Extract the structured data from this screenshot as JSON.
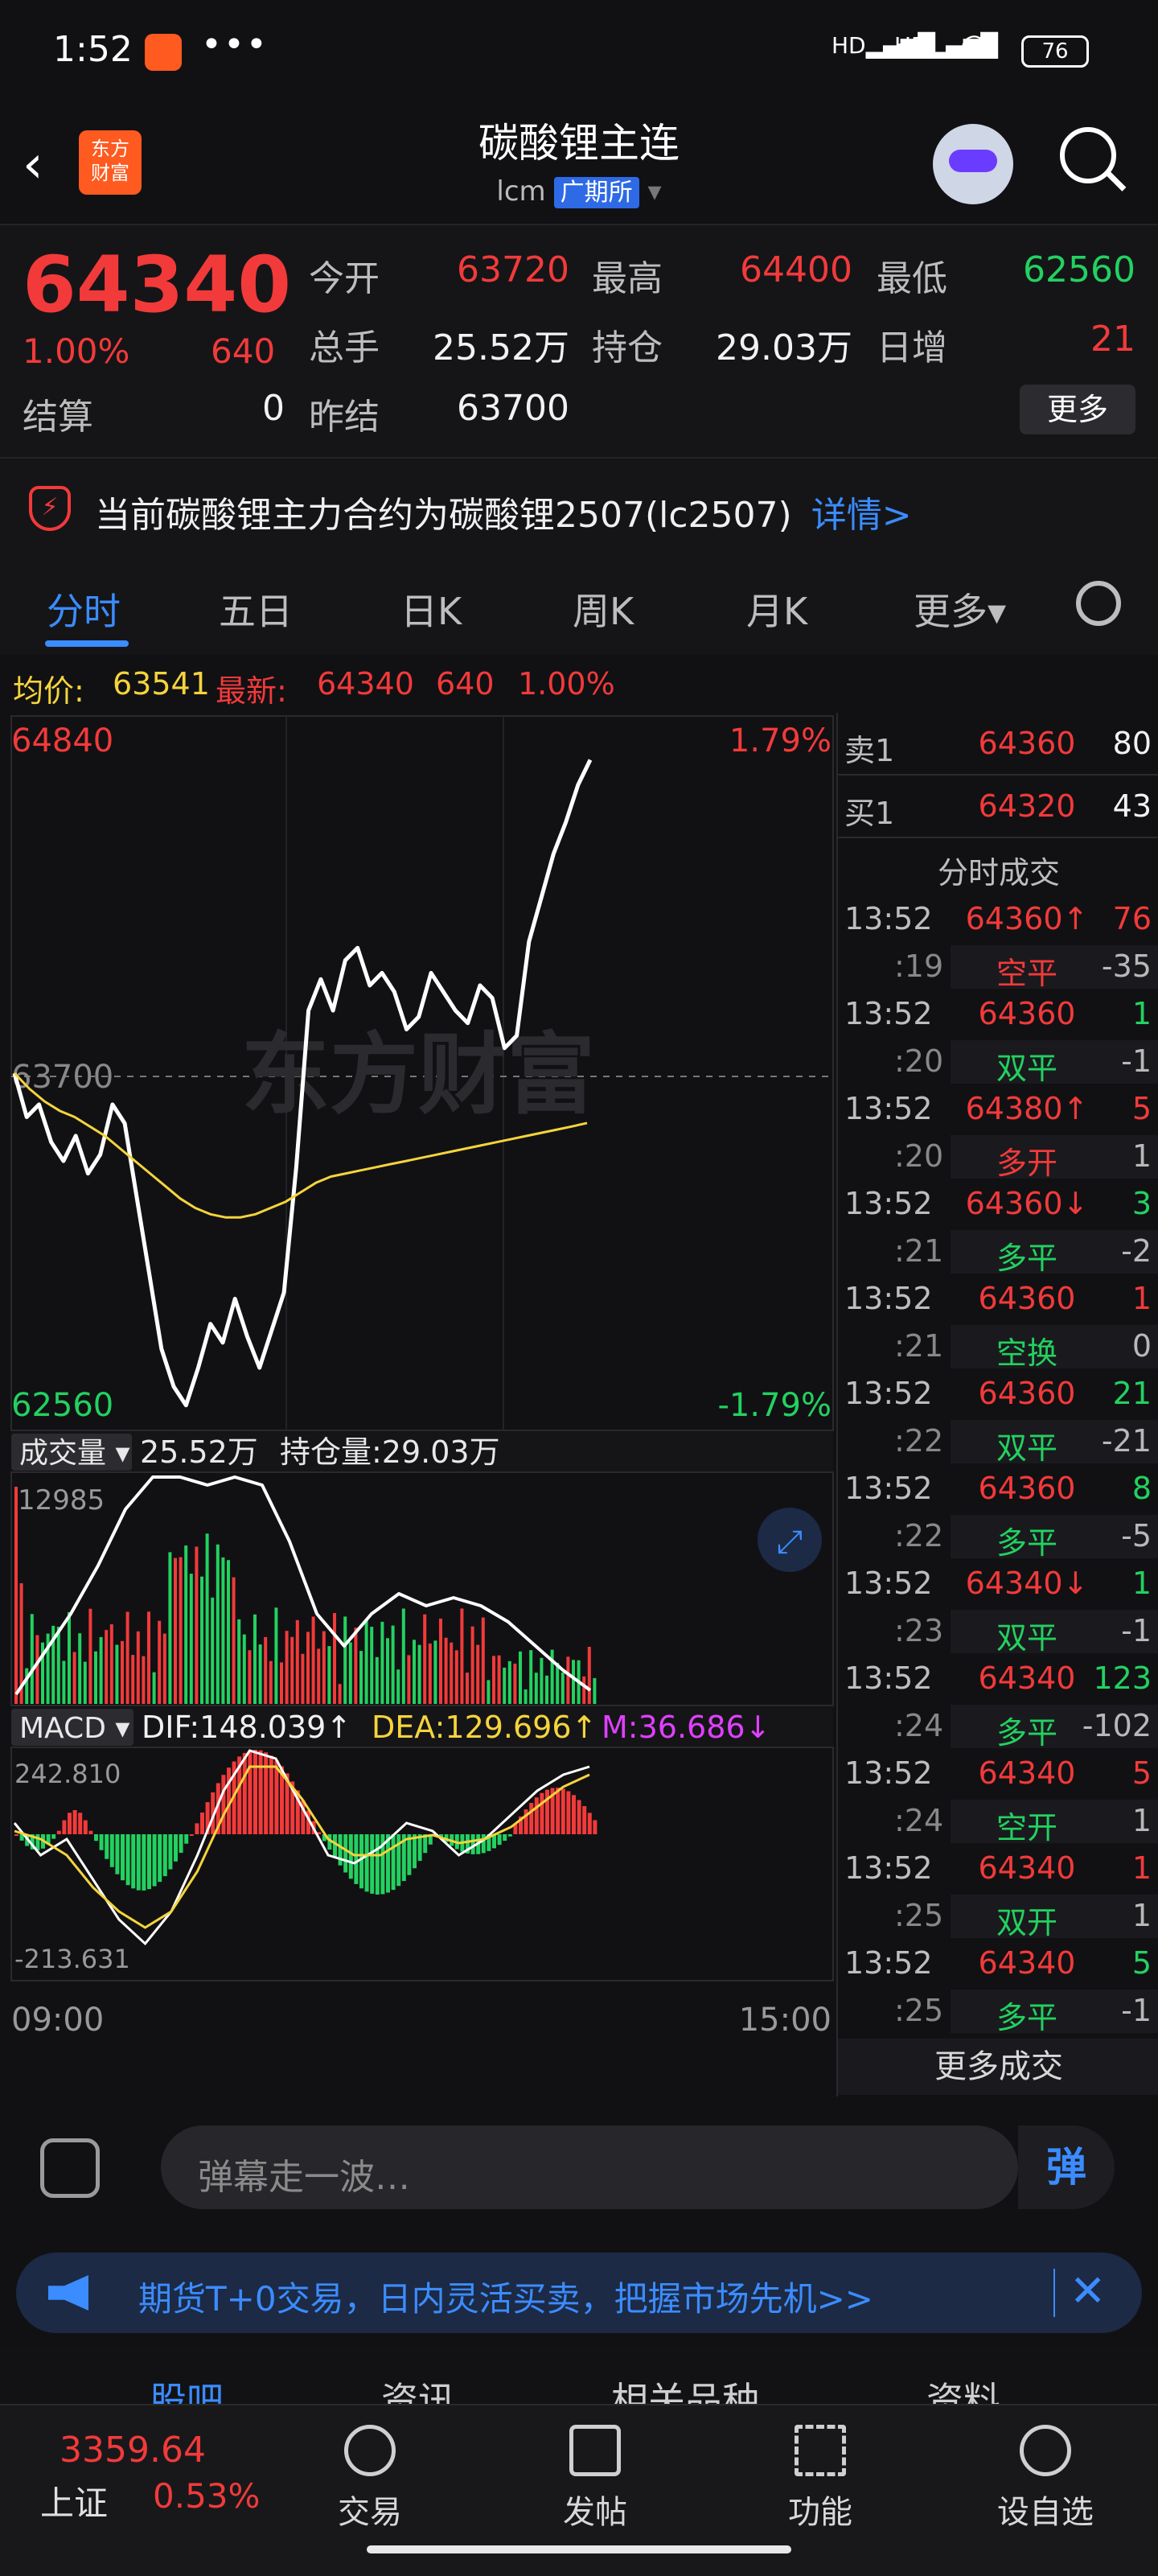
{
  "status_bar": {
    "time": "1:52",
    "more": "•••",
    "signal_labels": [
      "HD",
      "HD"
    ],
    "battery": "76"
  },
  "header": {
    "back": "‹",
    "logo": "东方\n财富",
    "logo_line1": "东方",
    "logo_line2": "财富",
    "title": "碳酸锂主连",
    "code": "lcm",
    "exchange": "广期所",
    "dropdown": "▾"
  },
  "quote": {
    "price": "64340",
    "pct": "1.00%",
    "change": "640",
    "fields": {
      "open_label": "今开",
      "open": "63720",
      "high_label": "最高",
      "high": "64400",
      "low_label": "最低",
      "low": "62560",
      "volume_label": "总手",
      "volume": "25.52万",
      "oi_label": "持仓",
      "oi": "29.03万",
      "daily_inc_label": "日增",
      "daily_inc": "21",
      "settle_label": "结算",
      "settle": "0",
      "prev_settle_label": "昨结",
      "prev_settle": "63700"
    },
    "more_button": "更多"
  },
  "notice": {
    "text": "当前碳酸锂主力合约为碳酸锂2507(lc2507)",
    "link": "详情>"
  },
  "tabs": [
    {
      "label": "分时",
      "active": true
    },
    {
      "label": "五日"
    },
    {
      "label": "日K"
    },
    {
      "label": "周K"
    },
    {
      "label": "月K"
    },
    {
      "label": "更多▾"
    }
  ],
  "avg_bar": {
    "avg_label": "均价:",
    "avg_value": "63541",
    "latest_label": "最新:",
    "latest_value": "64340",
    "latest_change": "640",
    "latest_pct": "1.00%"
  },
  "chart": {
    "price_high": "64840",
    "price_low": "62560",
    "pct_high": "1.79%",
    "pct_low": "-1.79%",
    "ref_price": "63700",
    "watermark": "东方财富",
    "volume_label": "成交量",
    "volume_value": "25.52万",
    "oi_label": "持仓量:29.03万",
    "volume_max": "12985",
    "macd_label": "MACD",
    "dif": "DIF:148.039↑",
    "dea": "DEA:129.696↑",
    "m": "M:36.686↓",
    "macd_max": "242.810",
    "macd_min": "-213.631",
    "time_start": "09:00",
    "time_end": "15:00"
  },
  "chart_data": {
    "type": "line",
    "title": "",
    "ylim": [
      62560,
      64840
    ],
    "series": [
      {
        "values": [
          63700,
          63560,
          63600,
          63480,
          63420,
          63500,
          63380,
          63440,
          63600,
          63540,
          63300,
          63060,
          62820,
          62700,
          62640,
          62760,
          62900,
          62840,
          62980,
          62860,
          62760,
          62880,
          63000,
          63400,
          63900,
          64000,
          63900,
          64060,
          64100,
          63980,
          64020,
          63960,
          63840,
          63880,
          64020,
          63960,
          63900,
          63860,
          63980,
          63940,
          63780,
          63820,
          64120,
          64260,
          64400,
          64500,
          64620,
          64700
        ]
      },
      {
        "values": [
          63700,
          63650,
          63610,
          63580,
          63560,
          63530,
          63500,
          63460,
          63420,
          63380,
          63340,
          63300,
          63270,
          63250,
          63240,
          63240,
          63250,
          63270,
          63290,
          63320,
          63350,
          63370,
          63380,
          63390,
          63400,
          63410,
          63420,
          63430,
          63440,
          63450,
          63460,
          63470,
          63480,
          63490,
          63500,
          63510,
          63520,
          63530,
          63541
        ]
      }
    ]
  },
  "trade_panel": {
    "ask_label": "卖1",
    "ask_price": "64360",
    "ask_vol": "80",
    "bid_label": "买1",
    "bid_price": "64320",
    "bid_vol": "43",
    "title": "分时成交",
    "rows": [
      {
        "time": "13:52",
        "mid": "64360↑",
        "qty": "76",
        "mid_color": "red",
        "qty_color": "red"
      },
      {
        "time": ":19",
        "mid": "空平",
        "qty": "-35",
        "mid_color": "red",
        "qty_color": "muted"
      },
      {
        "time": "13:52",
        "mid": "64360",
        "qty": "1",
        "mid_color": "red",
        "qty_color": "green"
      },
      {
        "time": ":20",
        "mid": "双平",
        "qty": "-1",
        "mid_color": "green",
        "qty_color": "muted"
      },
      {
        "time": "13:52",
        "mid": "64380↑",
        "qty": "5",
        "mid_color": "red",
        "qty_color": "red"
      },
      {
        "time": ":20",
        "mid": "多开",
        "qty": "1",
        "mid_color": "red",
        "qty_color": "muted"
      },
      {
        "time": "13:52",
        "mid": "64360↓",
        "qty": "3",
        "mid_color": "red",
        "qty_color": "green"
      },
      {
        "time": ":21",
        "mid": "多平",
        "qty": "-2",
        "mid_color": "green",
        "qty_color": "muted"
      },
      {
        "time": "13:52",
        "mid": "64360",
        "qty": "1",
        "mid_color": "red",
        "qty_color": "red"
      },
      {
        "time": ":21",
        "mid": "空换",
        "qty": "0",
        "mid_color": "green",
        "qty_color": "muted"
      },
      {
        "time": "13:52",
        "mid": "64360",
        "qty": "21",
        "mid_color": "red",
        "qty_color": "green"
      },
      {
        "time": ":22",
        "mid": "双平",
        "qty": "-21",
        "mid_color": "green",
        "qty_color": "muted"
      },
      {
        "time": "13:52",
        "mid": "64360",
        "qty": "8",
        "mid_color": "red",
        "qty_color": "green"
      },
      {
        "time": ":22",
        "mid": "多平",
        "qty": "-5",
        "mid_color": "green",
        "qty_color": "muted"
      },
      {
        "time": "13:52",
        "mid": "64340↓",
        "qty": "1",
        "mid_color": "red",
        "qty_color": "green"
      },
      {
        "time": ":23",
        "mid": "双平",
        "qty": "-1",
        "mid_color": "green",
        "qty_color": "muted"
      },
      {
        "time": "13:52",
        "mid": "64340",
        "qty": "123",
        "mid_color": "red",
        "qty_color": "green"
      },
      {
        "time": ":24",
        "mid": "多平",
        "qty": "-102",
        "mid_color": "green",
        "qty_color": "muted"
      },
      {
        "time": "13:52",
        "mid": "64340",
        "qty": "5",
        "mid_color": "red",
        "qty_color": "red"
      },
      {
        "time": ":24",
        "mid": "空开",
        "qty": "1",
        "mid_color": "green",
        "qty_color": "muted"
      },
      {
        "time": "13:52",
        "mid": "64340",
        "qty": "1",
        "mid_color": "red",
        "qty_color": "red"
      },
      {
        "time": ":25",
        "mid": "双开",
        "qty": "1",
        "mid_color": "green",
        "qty_color": "muted"
      },
      {
        "time": "13:52",
        "mid": "64340",
        "qty": "5",
        "mid_color": "red",
        "qty_color": "green"
      },
      {
        "time": ":25",
        "mid": "多平",
        "qty": "-1",
        "mid_color": "green",
        "qty_color": "muted"
      }
    ],
    "more": "更多成交"
  },
  "comment": {
    "placeholder": "弹幕走一波…",
    "danmu": "弹"
  },
  "promo": {
    "text": "期货T+0交易，日内灵活买卖，把握市场先机>>",
    "close": "✕"
  },
  "subtabs": [
    "股吧",
    "资讯",
    "相关品种",
    "资料"
  ],
  "bottom_nav": {
    "index_value": "3359.64",
    "index_name": "上证",
    "index_pct": "0.53%",
    "items": [
      "交易",
      "发帖",
      "功能",
      "设自选"
    ]
  },
  "colors": {
    "up": "#f23a3a",
    "down": "#23d160",
    "accent": "#3b8cff",
    "avg": "#f5d43c",
    "price_line": "#ffffff"
  }
}
